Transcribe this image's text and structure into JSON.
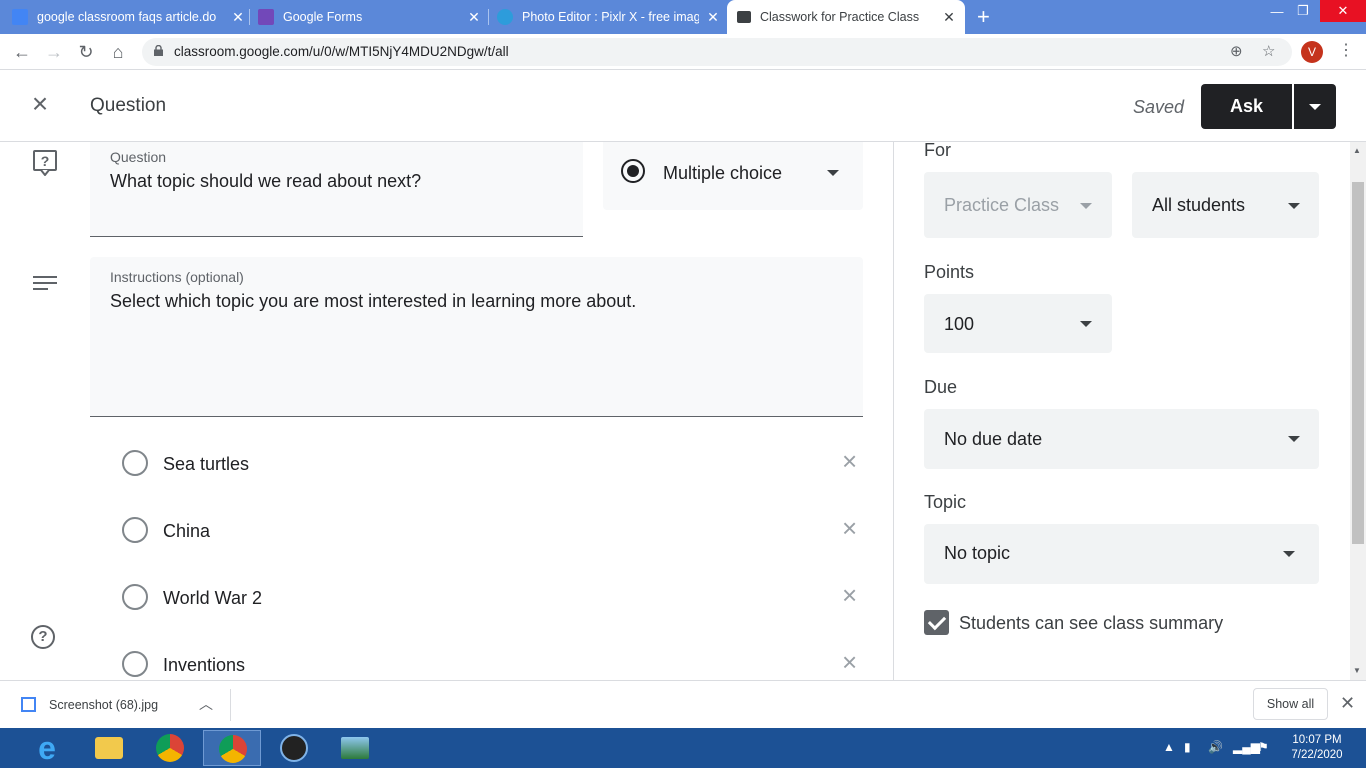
{
  "browser": {
    "tabs": [
      {
        "title": "google classroom faqs article.do",
        "favicon_color": "#4285f4"
      },
      {
        "title": "Google Forms",
        "favicon_color": "#7248b9"
      },
      {
        "title": "Photo Editor : Pixlr X - free image",
        "favicon_color": "#2d9cdb"
      },
      {
        "title": "Classwork for Practice Class",
        "favicon_color": "#3c4043"
      }
    ],
    "tab_close": "✕",
    "new_tab": "+",
    "url": "classroom.google.com/u/0/w/MTI5NjY4MDU2NDgw/t/all",
    "profile_initial": "V",
    "window_controls": [
      "—",
      "❐",
      "✕"
    ]
  },
  "header": {
    "title": "Question",
    "status": "Saved",
    "primary_button": "Ask"
  },
  "question": {
    "label": "Question",
    "value": "What topic should we read about next?",
    "type": "Multiple choice"
  },
  "instructions": {
    "label": "Instructions (optional)",
    "value": "Select which topic you are most interested in learning more about."
  },
  "options": [
    "Sea turtles",
    "China",
    "World War 2",
    "Inventions"
  ],
  "panel": {
    "for_label": "For",
    "class_value": "Practice Class",
    "students_value": "All students",
    "points_label": "Points",
    "points_value": "100",
    "due_label": "Due",
    "due_value": "No due date",
    "topic_label": "Topic",
    "topic_value": "No topic",
    "summary_label": "Students can see class summary",
    "summary_checked": true
  },
  "downloads": {
    "file_name": "Screenshot (68).jpg",
    "show_all": "Show all"
  },
  "taskbar": {
    "time": "10:07 PM",
    "date": "7/22/2020"
  },
  "colors": {
    "accent": "#202124",
    "tabstrip": "#5b88d9",
    "taskbar": "#1c5195"
  }
}
